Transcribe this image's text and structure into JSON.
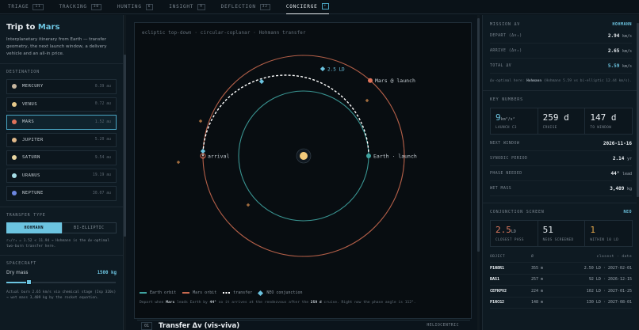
{
  "nav": {
    "tabs": [
      {
        "label": "TRIAGE",
        "badge": "11"
      },
      {
        "label": "TRACKING",
        "badge": "30"
      },
      {
        "label": "HUNTING",
        "badge": "6"
      },
      {
        "label": "INSIGHT",
        "badge": "9"
      },
      {
        "label": "DEFLECTION",
        "badge": "32"
      },
      {
        "label": "CONCIERGE",
        "badge": "+"
      }
    ],
    "active": "CONCIERGE"
  },
  "sidebar": {
    "title_prefix": "Trip to ",
    "title_target": "Mars",
    "description": "Interplanetary itinerary from Earth — transfer geometry, the next launch window, a delivery vehicle and an all-in price.",
    "destination_label": "DESTINATION",
    "destinations": [
      {
        "name": "MERCURY",
        "dist": "0.39 au",
        "color": "#c7b7a0"
      },
      {
        "name": "VENUS",
        "dist": "0.72 au",
        "color": "#e6c98a"
      },
      {
        "name": "MARS",
        "dist": "1.52 au",
        "color": "#e0735a"
      },
      {
        "name": "JUPITER",
        "dist": "5.20 au",
        "color": "#e0b88a"
      },
      {
        "name": "SATURN",
        "dist": "9.54 au",
        "color": "#ead6a0"
      },
      {
        "name": "URANUS",
        "dist": "19.19 au",
        "color": "#a6dde6"
      },
      {
        "name": "NEPTUNE",
        "dist": "30.07 au",
        "color": "#6d86e0"
      }
    ],
    "selected": "MARS",
    "transfer_label": "TRANSFER TYPE",
    "transfer_options": [
      "HOHMANN",
      "BI-ELLIPTIC"
    ],
    "transfer_selected": "HOHMANN",
    "transfer_note": "r₂/r₁ = 1.52 < 11.94 → Hohmann is the Δv-optimal two-burn transfer here.",
    "spacecraft_label": "SPACECRAFT",
    "dry_mass_label": "Dry mass",
    "dry_mass_value": "1500 kg",
    "dry_mass_fraction": 0.2,
    "spacecraft_note": "Actual burn 2.65 km/s via chemical stage (Isp 320s) → wet mass 3,409 kg by the rocket equation."
  },
  "diagram": {
    "caption": "ecliptic top-down · circular-coplanar · Hohmann transfer",
    "mars_label": "Mars @ launch",
    "earth_label": "Earth · launch",
    "arrival_label": "arrival",
    "ld_label": "2.5 LD",
    "legend": {
      "earth": "Earth orbit",
      "mars": "Mars orbit",
      "transfer": "transfer",
      "neo": "NEO conjunction"
    },
    "note_pre": "Depart when ",
    "note_mars": "Mars",
    "note_mid": " leads Earth by ",
    "note_angle": "44°",
    "note_mid2": " so it arrives at the rendezvous after the ",
    "note_days": "259 d",
    "note_post": " cruise. Right now the phase angle is 112°.",
    "colors": {
      "earth": "#3fa3a0",
      "mars": "#c7684f",
      "transfer": "#ffffff",
      "neo": "#6cc4e0",
      "sun": "#f2c97a"
    }
  },
  "transfer_section": {
    "number": "01",
    "title": "Transfer Δv (vis-viva)",
    "tag": "HELIOCENTRIC"
  },
  "mission": {
    "label": "MISSION ΔV",
    "tag": "HOHMANN",
    "rows": [
      {
        "k": "DEPART (Δv₁)",
        "v": "2.94",
        "u": "km/s"
      },
      {
        "k": "ARRIVE (Δv₂)",
        "v": "2.65",
        "u": "km/s"
      },
      {
        "k": "TOTAL ΔV",
        "v": "5.59",
        "u": "km/s"
      }
    ],
    "note_pre": "Δv-optimal here: ",
    "note_bold": "Hohmann",
    "note_post": " (Hohmann 5.59 vs bi-elliptic 12.44 km/s)."
  },
  "key_numbers": {
    "label": "KEY NUMBERS",
    "tiles": [
      {
        "big": "9",
        "unit": "km²/s²",
        "lbl": "LAUNCH C3"
      },
      {
        "big": "259 d",
        "unit": "",
        "lbl": "CRUISE"
      },
      {
        "big": "147 d",
        "unit": "",
        "lbl": "TO WINDOW"
      }
    ],
    "rows": [
      {
        "k": "NEXT WINDOW",
        "v": "2026-11-16",
        "u": ""
      },
      {
        "k": "SYNODIC PERIOD",
        "v": "2.14",
        "u": "yr"
      },
      {
        "k": "PHASE NEEDED",
        "v": "44°",
        "u": "lead"
      },
      {
        "k": "WET MASS",
        "v": "3,409",
        "u": "kg"
      }
    ]
  },
  "conjunction": {
    "label": "CONJUNCTION SCREEN",
    "tag": "NEO",
    "tiles": [
      {
        "big": "2.5",
        "unit": "LD",
        "lbl": "CLOSEST PASS"
      },
      {
        "big": "51",
        "unit": "",
        "lbl": "NEOS SCREENED"
      },
      {
        "big": "1",
        "unit": "",
        "lbl": "WITHIN 10 LD"
      }
    ],
    "headers": [
      "OBJECT",
      "Ø",
      "closest · date"
    ],
    "rows": [
      {
        "obj": "P1N8R1",
        "d": "355 m",
        "cl": "2.50 LD · 2027-02-01"
      },
      {
        "obj": "BAS1",
        "d": "257 m",
        "cl": "92 LD · 2026-12-15"
      },
      {
        "obj": "CEFKPV2",
        "d": "224 m",
        "cl": "102 LD · 2027-01-25"
      },
      {
        "obj": "P1NCG2",
        "d": "148 m",
        "cl": "130 LD · 2027-08-01"
      }
    ]
  }
}
